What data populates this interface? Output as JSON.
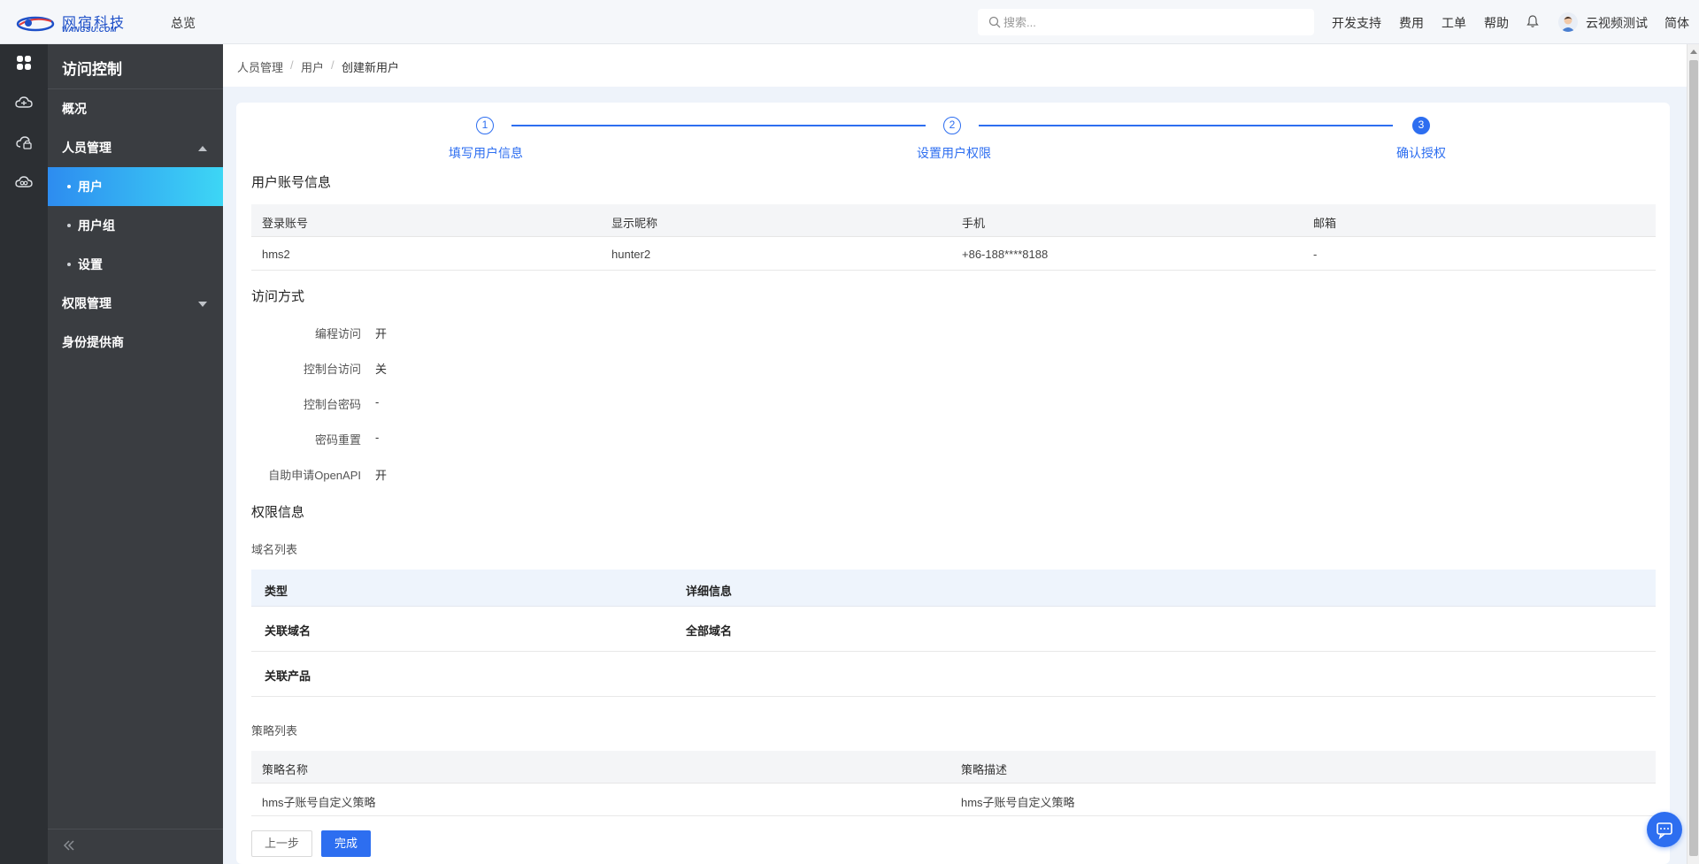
{
  "topbar": {
    "logo_cn": "网宿科技",
    "logo_en": "WANGSU.COM",
    "overview": "总览",
    "search_placeholder": "搜索...",
    "links": [
      "开发支持",
      "费用",
      "工单",
      "帮助"
    ],
    "user_name": "云视频测试",
    "language": "简体"
  },
  "rail": {
    "icons": [
      "apps-icon",
      "cloud-icon",
      "cloud-lock-icon",
      "cloud-link-icon"
    ]
  },
  "sidemenu": {
    "title": "访问控制",
    "items": {
      "overview": "概况",
      "people": "人员管理",
      "users": "用户",
      "user_groups": "用户组",
      "settings": "设置",
      "permissions": "权限管理",
      "identity_provider": "身份提供商"
    }
  },
  "breadcrumb": [
    "人员管理",
    "用户",
    "创建新用户"
  ],
  "steps": [
    {
      "num": "1",
      "label": "填写用户信息"
    },
    {
      "num": "2",
      "label": "设置用户权限"
    },
    {
      "num": "3",
      "label": "确认授权"
    }
  ],
  "account": {
    "title": "用户账号信息",
    "headers": [
      "登录账号",
      "显示昵称",
      "手机",
      "邮箱"
    ],
    "row": [
      "hms2",
      "hunter2",
      "+86-188****8188",
      "-"
    ]
  },
  "access": {
    "title": "访问方式",
    "items": [
      {
        "label": "编程访问",
        "value": "开"
      },
      {
        "label": "控制台访问",
        "value": "关"
      },
      {
        "label": "控制台密码",
        "value": "-"
      },
      {
        "label": "密码重置",
        "value": "-"
      },
      {
        "label": "自助申请OpenAPI",
        "value": "开"
      }
    ]
  },
  "permission": {
    "title": "权限信息",
    "domain_list_title": "域名列表",
    "domain_headers": [
      "类型",
      "详细信息"
    ],
    "domain_rows": [
      [
        "关联域名",
        "全部域名"
      ],
      [
        "关联产品",
        ""
      ]
    ],
    "policy_list_title": "策略列表",
    "policy_headers": [
      "策略名称",
      "策略描述"
    ],
    "policy_rows": [
      [
        "hms子账号自定义策略",
        "hms子账号自定义策略"
      ]
    ]
  },
  "buttons": {
    "prev": "上一步",
    "done": "完成"
  },
  "colors": {
    "primary": "#2d6ef0",
    "sidebar": "#3a3d41",
    "rail": "#2c2f33"
  }
}
